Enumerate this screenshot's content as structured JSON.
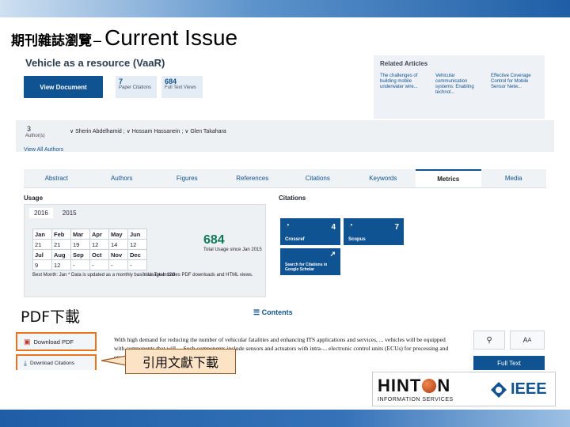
{
  "slide": {
    "title_cjk": "期刊雜誌瀏覽",
    "title_dash": "–",
    "title_en": "Current Issue",
    "pdf_label": "PDF下載",
    "callout": "引用文獻下載"
  },
  "article": {
    "title": "Vehicle as a resource (VaaR)",
    "view_button": "View Document",
    "metrics": [
      {
        "value": "7",
        "label": "Paper Citations"
      },
      {
        "value": "684",
        "label": "Full Text Views"
      }
    ]
  },
  "related": {
    "heading": "Related Articles",
    "items": [
      "The challenges of building mobile underwater wire...",
      "Vehicular communication systems: Enabling technol...",
      "Effective Coverage Control for Mobile Sensor Netw..."
    ]
  },
  "authors": {
    "count": "3",
    "count_label": "Author(s)",
    "names": "∨ Sherin Abdelhamid ; ∨ Hossam Hassanein ; ∨ Glen Takahara",
    "view_all": "View All Authors"
  },
  "tabs": [
    "Abstract",
    "Authors",
    "Figures",
    "References",
    "Citations",
    "Keywords",
    "Metrics",
    "Media"
  ],
  "active_tab": "Metrics",
  "usage": {
    "heading": "Usage",
    "years": [
      "2016",
      "2015"
    ],
    "table": [
      [
        "Jan",
        "Feb",
        "Mar",
        "Apr",
        "May",
        "Jun"
      ],
      [
        "21",
        "21",
        "19",
        "12",
        "14",
        "12"
      ],
      [
        "Jul",
        "Aug",
        "Sep",
        "Oct",
        "Nov",
        "Dec"
      ],
      [
        "9",
        "12",
        "-",
        "-",
        "-",
        "-"
      ]
    ],
    "total_value": "684",
    "total_label": "Total Usage since Jan 2015",
    "year_total": "Year Total: 120",
    "note": "Best Month: Jan  * Data is updated as a monthly basis. Usage includes PDF downloads and HTML views."
  },
  "citations": {
    "heading": "Citations",
    "crossref": {
      "label": "Crossref",
      "value": "4"
    },
    "scopus": {
      "label": "Scopus",
      "value": "7"
    },
    "scholar": "Search for Citations in Google Scholar"
  },
  "contents": {
    "heading": "Contents",
    "abstract": "With high demand for reducing the number of vehicular fatalities and enhancing ITS applications and services, ... vehicles will be equipped with components that will ... Such components include sensors and actuators with intra-... electronic control units (ECUs) for processing and operation control."
  },
  "downloads": {
    "pdf": "Download PDF",
    "citations": "Download Citations"
  },
  "toolbar": {
    "aa": "A",
    "aa_small": "A",
    "fulltext": "Full Text"
  },
  "logos": {
    "hinton_pre": "HINT",
    "hinton_post": "N",
    "hinton_sub": "INFORMATION SERVICES",
    "ieee": "IEEE"
  }
}
